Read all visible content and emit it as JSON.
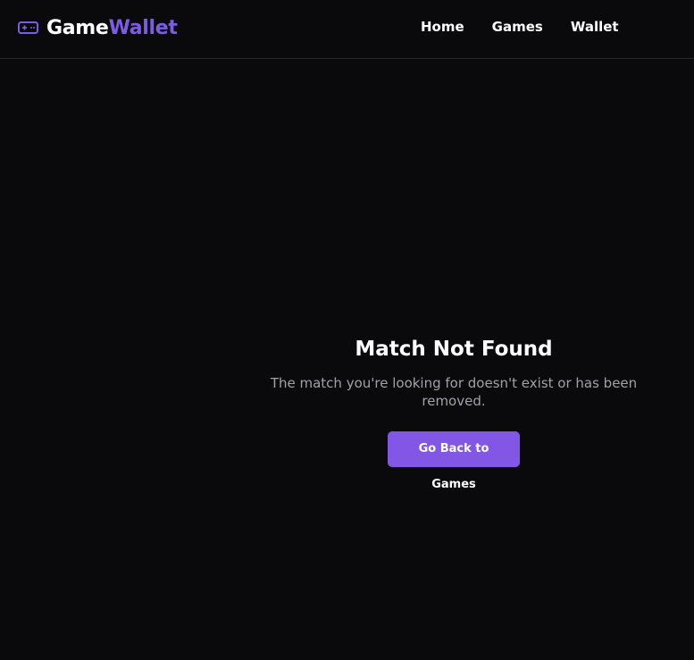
{
  "brand": {
    "name_part1": "Game",
    "name_part2": "Wallet",
    "icon": "gamepad-icon",
    "accent_color": "#7c5ce6"
  },
  "nav": {
    "items": [
      {
        "label": "Home"
      },
      {
        "label": "Games"
      },
      {
        "label": "Wallet"
      }
    ]
  },
  "main": {
    "title": "Match Not Found",
    "message": "The match you're looking for doesn't exist or has been removed.",
    "button_label": "Go Back to Games",
    "button_color": "#8257e6"
  }
}
